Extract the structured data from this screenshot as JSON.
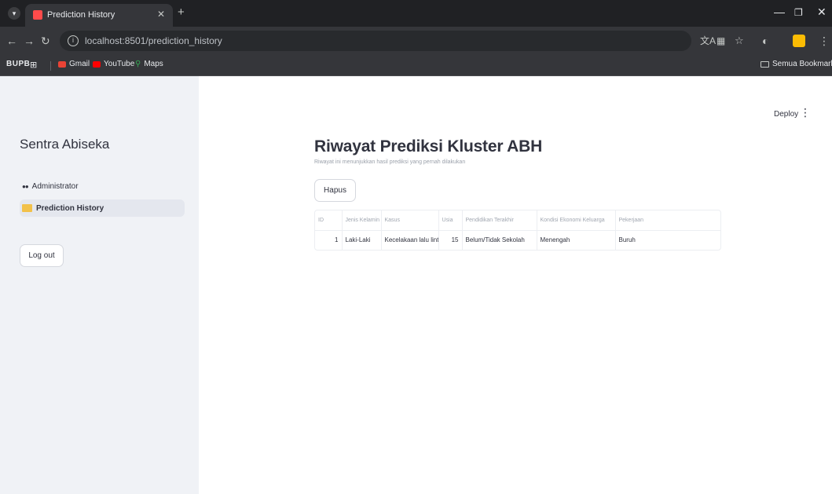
{
  "browser": {
    "tab_title": "Prediction History",
    "tab_close": "✕",
    "new_tab": "+",
    "url": "localhost:8501/prediction_history",
    "bookmarks": {
      "apps": "BUPB",
      "gmail": "Gmail",
      "youtube": "YouTube",
      "maps": "Maps",
      "all": "Semua Bookmark"
    }
  },
  "header": {
    "deploy": "Deploy",
    "menu": "⋮"
  },
  "sidebar": {
    "brand": "Sentra Abiseka",
    "items": [
      {
        "label": "Administrator",
        "icon": "user-group-icon"
      },
      {
        "label": "Prediction History",
        "icon": "folder-icon"
      }
    ],
    "logout": "Log out"
  },
  "main": {
    "title": "Riwayat Prediksi Kluster ABH",
    "caption": "Riwayat ini menunjukkan hasil prediksi yang pernah dilakukan",
    "delete_button": "Hapus",
    "table": {
      "columns": [
        "ID",
        "Jenis Kelamin",
        "Kasus",
        "Usia",
        "Pendidikan Terakhir",
        "Kondisi Ekonomi Keluarga",
        "Pekerjaan"
      ],
      "rows": [
        [
          "1",
          "Laki-Laki",
          "Kecelakaan lalu lintas",
          "15",
          "Belum/Tidak Sekolah",
          "Menengah",
          "Buruh"
        ]
      ]
    }
  },
  "colors": {
    "sidebar_bg": "#f0f2f6",
    "text": "#31333f",
    "chrome_bg": "#202124",
    "accent": "#ff4b4b"
  }
}
